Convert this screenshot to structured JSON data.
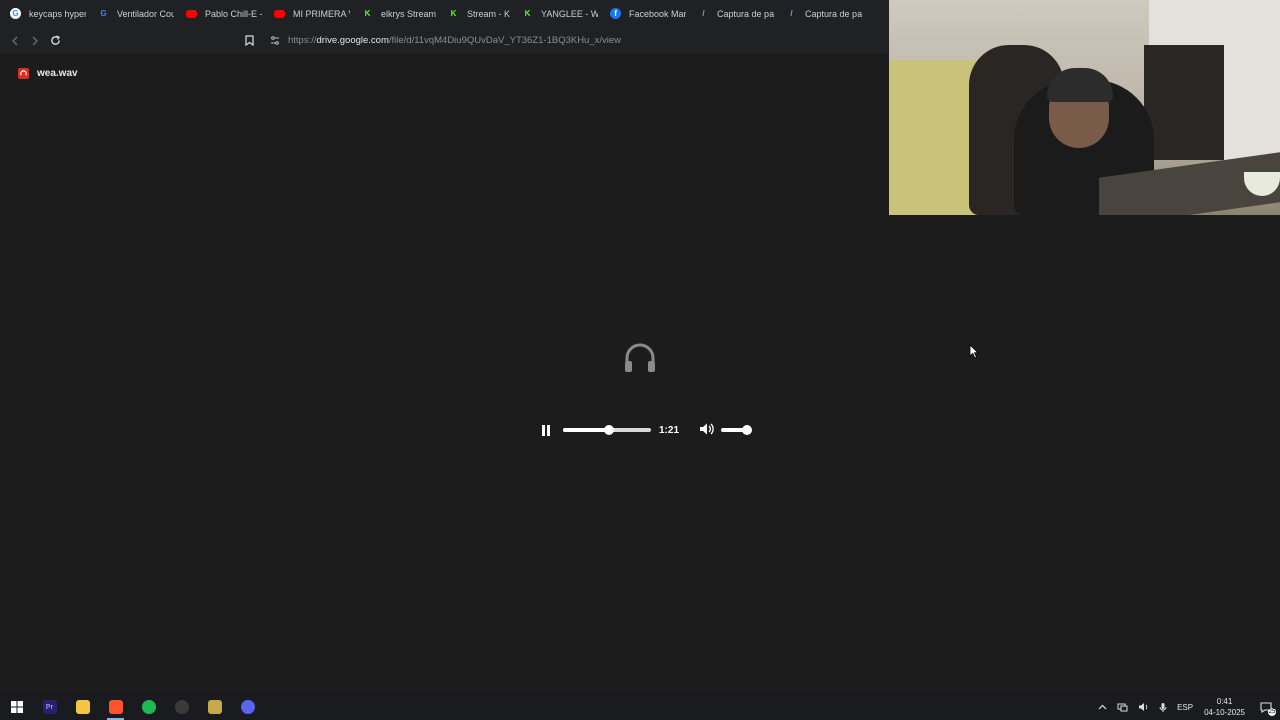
{
  "bookmarks": [
    {
      "label": "keycaps hyperx",
      "icon": "google-icon",
      "color": "#ffffff"
    },
    {
      "label": "Ventilador Cou",
      "icon": "google-lens-icon",
      "color": "#4285f4"
    },
    {
      "label": "Pablo Chill-E -",
      "icon": "youtube-icon",
      "color": "#ff0000"
    },
    {
      "label": "MI PRIMERA VE",
      "icon": "youtube-icon",
      "color": "#ff0000"
    },
    {
      "label": "elkrys Stream",
      "icon": "kick-icon",
      "color": "#53fc18"
    },
    {
      "label": "Stream - K",
      "icon": "kick-icon",
      "color": "#53fc18"
    },
    {
      "label": "YANGLEE - Wat",
      "icon": "kick-icon",
      "color": "#53fc18"
    },
    {
      "label": "Facebook Mark",
      "icon": "facebook-icon",
      "color": "#1877f2"
    },
    {
      "label": "Captura de pan",
      "icon": "pen-icon",
      "color": "#a78bfa"
    },
    {
      "label": "Captura de pan",
      "icon": "pen-icon",
      "color": "#a78bfa"
    }
  ],
  "address": {
    "prefix": "https://",
    "host": "drive.google.com",
    "path": "/file/d/11vqM4Diu9QUvDaV_YT36Z1-1BQ3KHu_x/view"
  },
  "file": {
    "name": "wea.wav"
  },
  "player": {
    "state": "playing",
    "time": "1:21",
    "progress": 0.52,
    "volume": 1.0
  },
  "taskbar": {
    "apps": [
      {
        "name": "windows-start-icon",
        "label": "",
        "color": "#ffffff"
      },
      {
        "name": "premiere-pro-icon",
        "label": "Pr",
        "color": "#2a1f6b"
      },
      {
        "name": "file-explorer-icon",
        "label": "",
        "color": "#f4c542"
      },
      {
        "name": "brave-browser-icon",
        "label": "",
        "color": "#fb542b"
      },
      {
        "name": "spotify-icon",
        "label": "",
        "color": "#1db954"
      },
      {
        "name": "obs-icon",
        "label": "",
        "color": "#3a3a3a"
      },
      {
        "name": "league-of-legends-icon",
        "label": "",
        "color": "#c8a94a"
      },
      {
        "name": "discord-icon",
        "label": "",
        "color": "#5865f2"
      }
    ],
    "language": "ESP",
    "time": "0:41",
    "date": "04-10-2025"
  }
}
